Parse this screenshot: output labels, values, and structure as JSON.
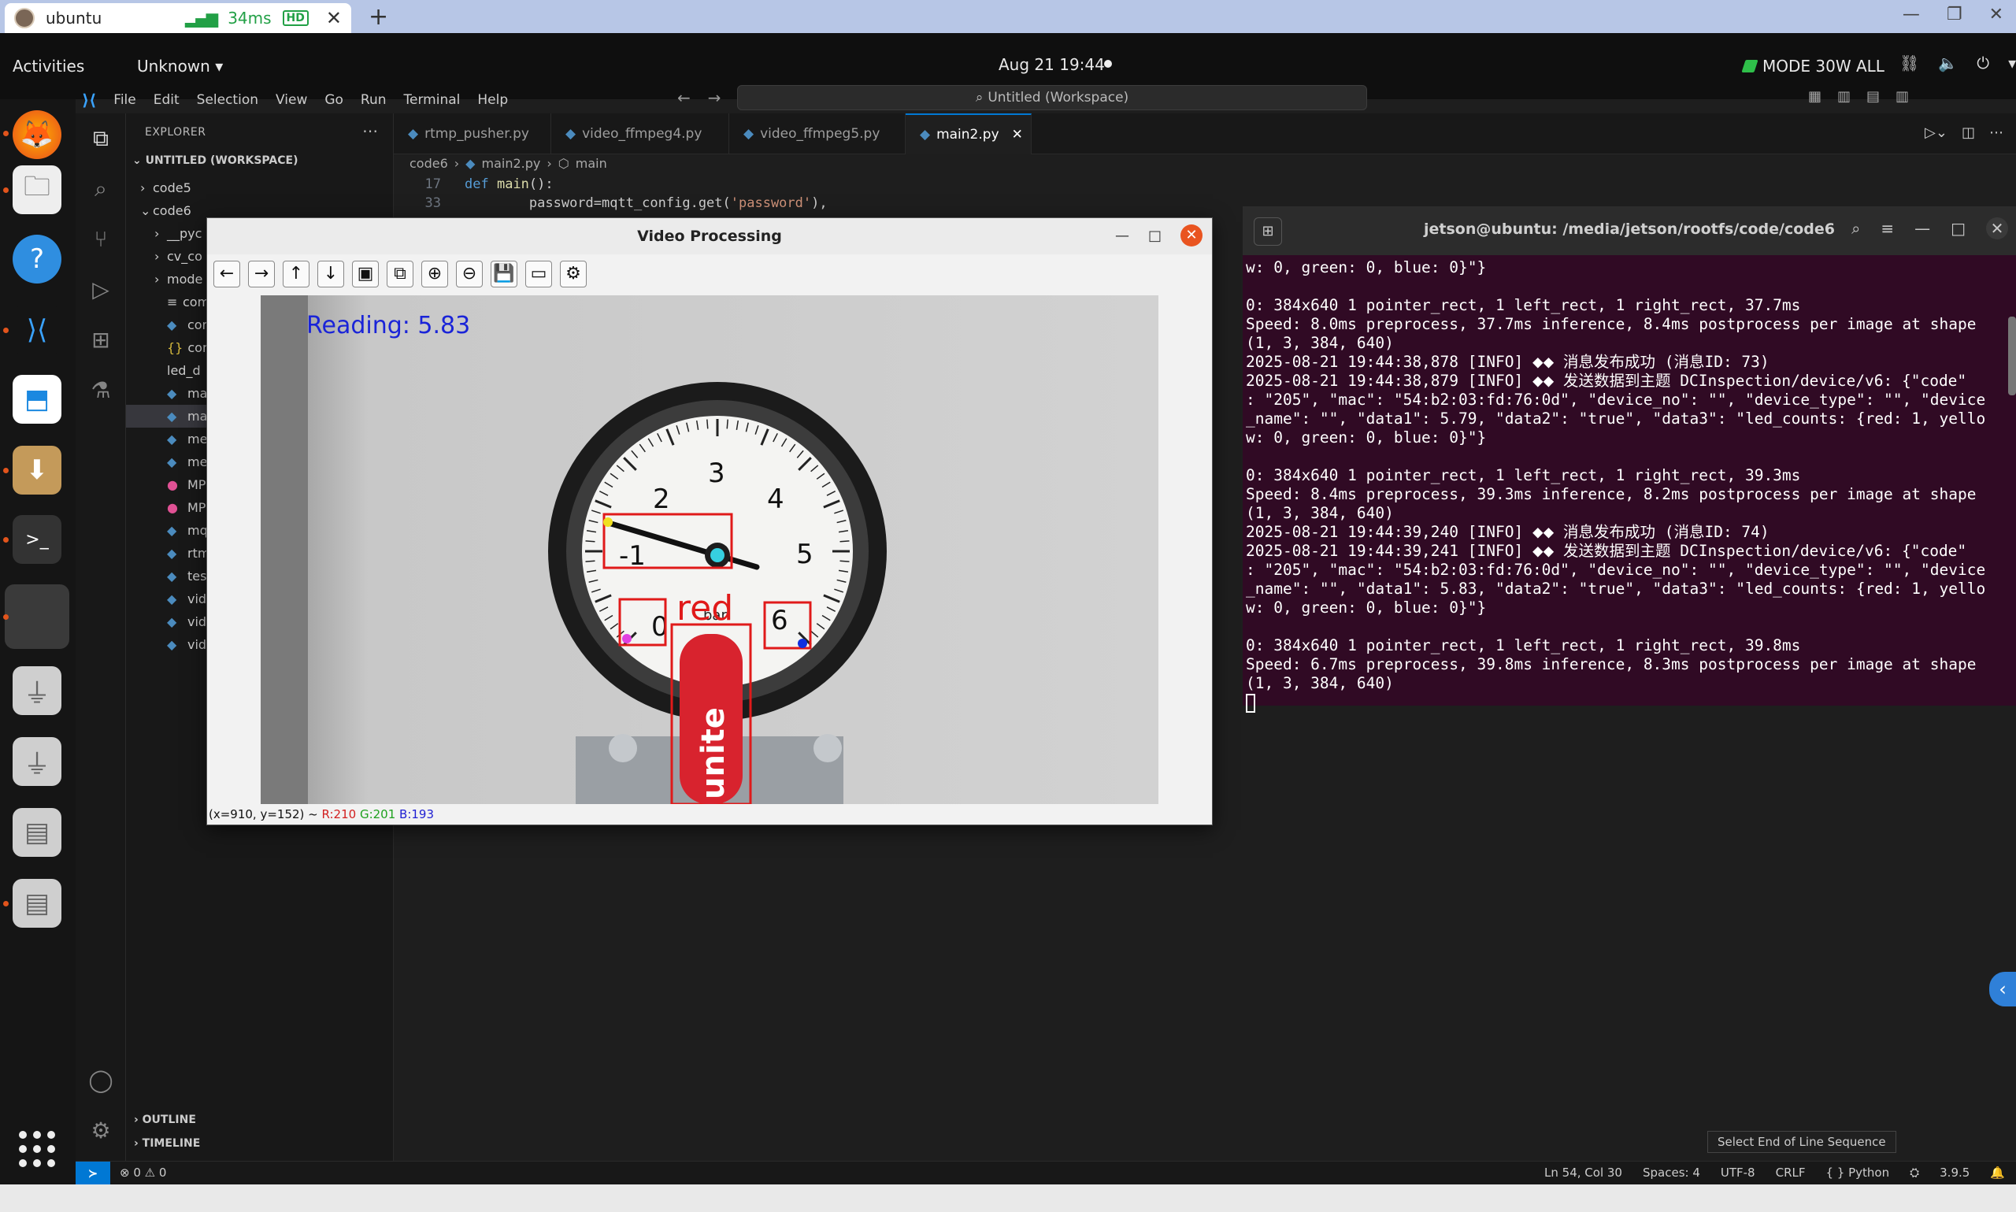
{
  "remote": {
    "tab_title": "ubuntu",
    "latency": "34ms",
    "quality": "HD",
    "close": "✕",
    "new_tab": "+",
    "win_controls": [
      "—",
      "❐",
      "✕"
    ]
  },
  "topbar": {
    "activities": "Activities",
    "app_menu": "Unknown ▾",
    "clock": "Aug 21  19:44",
    "power_mode": "MODE 30W ALL",
    "tray_icons": [
      "network-icon",
      "volume-icon",
      "power-icon",
      "chevron-down-icon"
    ]
  },
  "vscode": {
    "menu": [
      "File",
      "Edit",
      "Selection",
      "View",
      "Go",
      "Run",
      "Terminal",
      "Help"
    ],
    "command_center": "Untitled (Workspace)",
    "explorer_title": "EXPLORER",
    "workspace": "UNTITLED (WORKSPACE)",
    "tree": [
      {
        "indent": 18,
        "chev": "›",
        "icon": "",
        "label": "code5",
        "kind": "folder"
      },
      {
        "indent": 18,
        "chev": "⌄",
        "icon": "",
        "label": "code6",
        "kind": "folder"
      },
      {
        "indent": 36,
        "chev": "›",
        "icon": "",
        "label": "__pyc",
        "kind": "folder"
      },
      {
        "indent": 36,
        "chev": "›",
        "icon": "",
        "label": "cv_co",
        "kind": "folder"
      },
      {
        "indent": 36,
        "chev": "›",
        "icon": "",
        "label": "mode",
        "kind": "folder"
      },
      {
        "indent": 36,
        "chev": "",
        "icon": "≡",
        "label": "comb",
        "kind": "file"
      },
      {
        "indent": 36,
        "chev": "",
        "icon": "◆",
        "label": "config",
        "kind": "py"
      },
      {
        "indent": 36,
        "chev": "",
        "icon": "{}",
        "label": "config",
        "kind": "json"
      },
      {
        "indent": 36,
        "chev": "",
        "icon": "",
        "label": "led_d",
        "kind": "file"
      },
      {
        "indent": 36,
        "chev": "",
        "icon": "◆",
        "label": "main1",
        "kind": "py"
      },
      {
        "indent": 36,
        "chev": "",
        "icon": "◆",
        "label": "main2",
        "kind": "py",
        "selected": true
      },
      {
        "indent": 36,
        "chev": "",
        "icon": "◆",
        "label": "meter",
        "kind": "py"
      },
      {
        "indent": 36,
        "chev": "",
        "icon": "◆",
        "label": "meter",
        "kind": "py"
      },
      {
        "indent": 36,
        "chev": "",
        "icon": "●",
        "label": "MP41",
        "kind": "mp4"
      },
      {
        "indent": 36,
        "chev": "",
        "icon": "●",
        "label": "MP42",
        "kind": "mp4"
      },
      {
        "indent": 36,
        "chev": "",
        "icon": "◆",
        "label": "mqtt_",
        "kind": "py"
      },
      {
        "indent": 36,
        "chev": "",
        "icon": "◆",
        "label": "rtmp_",
        "kind": "py"
      },
      {
        "indent": 36,
        "chev": "",
        "icon": "◆",
        "label": "test_b",
        "kind": "py"
      },
      {
        "indent": 36,
        "chev": "",
        "icon": "◆",
        "label": "video",
        "kind": "py"
      },
      {
        "indent": 36,
        "chev": "",
        "icon": "◆",
        "label": "video",
        "kind": "py"
      },
      {
        "indent": 36,
        "chev": "",
        "icon": "◆",
        "label": "video",
        "kind": "py"
      }
    ],
    "outline": "OUTLINE",
    "timeline": "TIMELINE",
    "tabs": [
      {
        "label": "rtmp_pusher.py",
        "active": false
      },
      {
        "label": "video_ffmpeg4.py",
        "active": false
      },
      {
        "label": "video_ffmpeg5.py",
        "active": false
      },
      {
        "label": "main2.py",
        "active": true
      }
    ],
    "breadcrumb": [
      "code6",
      "›",
      "main2.py",
      "›",
      "main"
    ],
    "code_lines": [
      {
        "num": "17",
        "kw": "def ",
        "fn": "main",
        "rest": "():"
      },
      {
        "num": "33",
        "indent": "        ",
        "text": "password=mqtt_config.get(",
        "str": "'password'",
        "tail": "),"
      }
    ],
    "status": {
      "problems": "⊗ 0 ⚠ 0",
      "position": "Ln 54, Col 30",
      "spaces": "Spaces: 4",
      "encoding": "UTF-8",
      "eol": "CRLF",
      "language": "{ } Python",
      "version": "3.9.5"
    },
    "eol_tooltip": "Select End of Line Sequence"
  },
  "video_window": {
    "title": "Video Processing",
    "toolbar_icons": [
      "arrow-left-icon",
      "arrow-right-icon",
      "arrow-up-icon",
      "arrow-down-icon",
      "zoom-fit-icon",
      "zoom-window-icon",
      "zoom-in-icon",
      "zoom-out-icon",
      "save-icon",
      "copy-icon",
      "properties-icon"
    ],
    "toolbar_glyphs": [
      "←",
      "→",
      "↑",
      "↓",
      "▣",
      "⧉",
      "⊕",
      "⊖",
      "💾",
      "▭",
      "⚙"
    ],
    "overlay_reading": "Reading: 5.83",
    "overlay_label": "red",
    "gauge_unit": "bar",
    "gauge_numbers": [
      "-1",
      "0",
      "2",
      "3",
      "4",
      "5",
      "6"
    ],
    "brand_text": "unite",
    "status_coords": "(x=910, y=152) ~",
    "status_r": "R:210",
    "status_g": "G:201",
    "status_b": "B:193"
  },
  "terminal": {
    "title": "jetson@ubuntu: /media/jetson/rootfs/code/code6",
    "lines": [
      "w: 0, green: 0, blue: 0}\"}",
      "",
      "0: 384x640 1 pointer_rect, 1 left_rect, 1 right_rect, 37.7ms",
      "Speed: 8.0ms preprocess, 37.7ms inference, 8.4ms postprocess per image at shape",
      "(1, 3, 384, 640)",
      "2025-08-21 19:44:38,878 [INFO] ⬥⬥ 消息发布成功 (消息ID: 73)",
      "2025-08-21 19:44:38,879 [INFO] ⬥⬥ 发送数据到主题 DCInspection/device/v6: {\"code\"",
      ": \"205\", \"mac\": \"54:b2:03:fd:76:0d\", \"device_no\": \"\", \"device_type\": \"\", \"device",
      "_name\": \"\", \"data1\": 5.79, \"data2\": \"true\", \"data3\": \"led_counts: {red: 1, yello",
      "w: 0, green: 0, blue: 0}\"}",
      "",
      "0: 384x640 1 pointer_rect, 1 left_rect, 1 right_rect, 39.3ms",
      "Speed: 8.4ms preprocess, 39.3ms inference, 8.2ms postprocess per image at shape",
      "(1, 3, 384, 640)",
      "2025-08-21 19:44:39,240 [INFO] ⬥⬥ 消息发布成功 (消息ID: 74)",
      "2025-08-21 19:44:39,241 [INFO] ⬥⬥ 发送数据到主题 DCInspection/device/v6: {\"code\"",
      ": \"205\", \"mac\": \"54:b2:03:fd:76:0d\", \"device_no\": \"\", \"device_type\": \"\", \"device",
      "_name\": \"\", \"data1\": 5.83, \"data2\": \"true\", \"data3\": \"led_counts: {red: 1, yello",
      "w: 0, green: 0, blue: 0}\"}",
      "",
      "0: 384x640 1 pointer_rect, 1 left_rect, 1 right_rect, 39.8ms",
      "Speed: 6.7ms preprocess, 39.8ms inference, 8.3ms postprocess per image at shape",
      "(1, 3, 384, 640)"
    ]
  }
}
